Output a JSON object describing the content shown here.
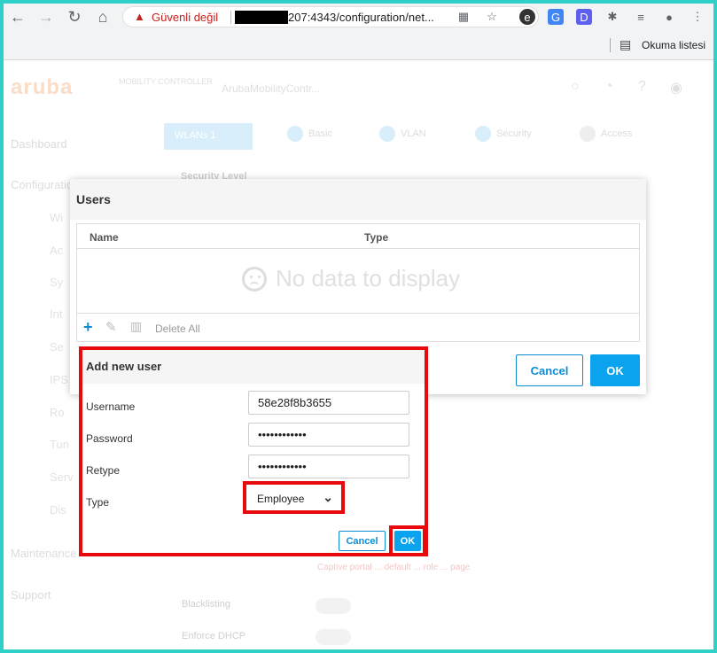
{
  "browser": {
    "warning_icon": "warning-triangle-icon",
    "security_warning": "Güvenli değil",
    "url": "207:4343/configuration/net...",
    "reading_list": "Okuma listesi"
  },
  "app": {
    "logo": "aruba",
    "logo_sub": "MOBILITY CONTROLLER",
    "hostname": "ArubaMobilityContr...",
    "sidebar": [
      "Dashboard",
      "Configuration",
      "Maintenance",
      "Support"
    ],
    "sidebar_sub": [
      "Wi",
      "Ac",
      "Sy",
      "Int",
      "Se",
      "IPS",
      "Ro",
      "Tun",
      "Serv",
      "Dis"
    ],
    "wizard_step": "WLANs 1",
    "steps": [
      "Basic",
      "VLAN",
      "Security",
      "Access"
    ],
    "security_level_label": "Security Level",
    "bg_error": "Captive portal ... default ... role ... page",
    "blacklisting_label": "Blacklisting",
    "enforce_dhcp_label": "Enforce DHCP"
  },
  "users_dialog": {
    "title": "Users",
    "columns": [
      "Name",
      "Type"
    ],
    "empty_text": "No data to display",
    "delete_all": "Delete All",
    "cancel": "Cancel",
    "ok": "OK"
  },
  "add_user_dialog": {
    "title": "Add new user",
    "username_label": "Username",
    "username_value": "58e28f8b3655",
    "password_label": "Password",
    "password_value": "••••••••••••",
    "retype_label": "Retype",
    "retype_value": "••••••••••••",
    "type_label": "Type",
    "type_value": "Employee",
    "cancel": "Cancel",
    "ok": "OK"
  },
  "colors": {
    "highlight": "#e8090d",
    "accent": "#0ba3ee",
    "frame": "#2fd0c8"
  }
}
